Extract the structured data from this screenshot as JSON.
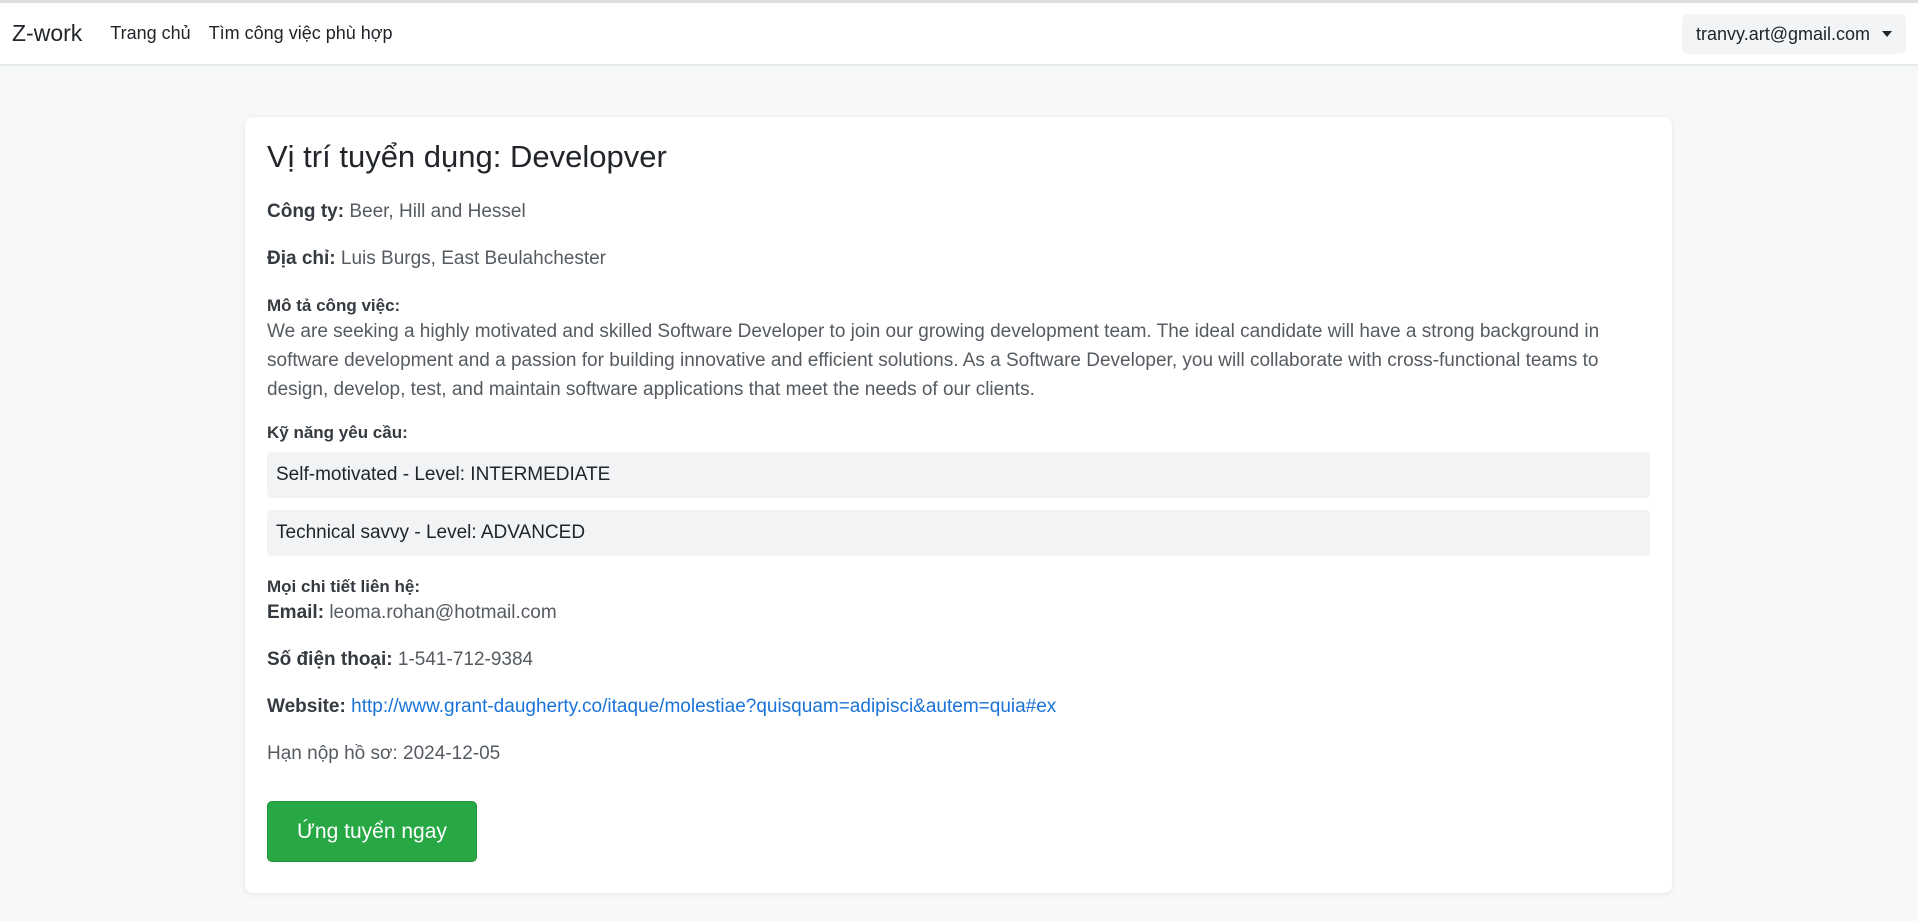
{
  "navbar": {
    "brand": "Z-work",
    "links": [
      "Trang chủ",
      "Tìm công việc phù hợp"
    ],
    "user_email": "tranvy.art@gmail.com"
  },
  "job": {
    "title": "Vị trí tuyển dụng: Developver",
    "company_label": "Công ty:",
    "company": "Beer, Hill and Hessel",
    "address_label": "Địa chỉ:",
    "address": "Luis Burgs, East Beulahchester",
    "description_label": "Mô tả công việc:",
    "description": "We are seeking a highly motivated and skilled Software Developer to join our growing development team. The ideal candidate will have a strong background in software development and a passion for building innovative and efficient solutions. As a Software Developer, you will collaborate with cross-functional teams to design, develop, test, and maintain software applications that meet the needs of our clients.",
    "skills_label": "Kỹ năng yêu cầu:",
    "skills": [
      "Self-motivated - Level: INTERMEDIATE",
      "Technical savvy - Level: ADVANCED"
    ],
    "contact_label": "Mọi chi tiết liên hệ:",
    "email_label": "Email:",
    "email": "leoma.rohan@hotmail.com",
    "phone_label": "Số điện thoại:",
    "phone": "1-541-712-9384",
    "website_label": "Website:",
    "website": "http://www.grant-daugherty.co/itaque/molestiae?quisquam=adipisci&autem=quia#ex",
    "deadline": "Hạn nộp hồ sơ: 2024-12-05",
    "apply_label": "Ứng tuyển ngay"
  },
  "colors": {
    "apply_button": "#28a745",
    "link": "#1a73d9"
  }
}
